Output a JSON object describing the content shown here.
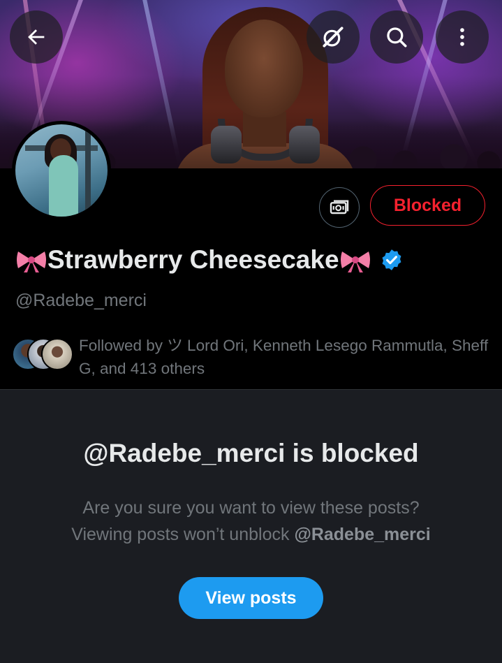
{
  "header": {
    "back_icon": "arrow-left-icon",
    "grok_icon": "grok-slash-icon",
    "search_icon": "search-icon",
    "more_icon": "more-vertical-icon"
  },
  "profile": {
    "display_name": "Strawberry Cheesecake",
    "name_emoji_left": "ribbon-emoji",
    "name_emoji_right": "ribbon-emoji",
    "verified_icon": "verified-badge-icon",
    "handle": "@Radebe_merci",
    "blocked_label": "Blocked",
    "tip_icon": "money-icon",
    "followed_by": "Followed by ツ Lord Ori, Kenneth Lesego Rammutla, Sheff G, and 413 others"
  },
  "blocked_notice": {
    "title": "@Radebe_merci is blocked",
    "desc_line1": "Are you sure you want to view these posts?",
    "desc_line2_prefix": "Viewing posts won’t unblock",
    "desc_line2_handle": "@Radebe_merci",
    "view_posts_label": "View posts"
  },
  "colors": {
    "accent": "#1d9bf0",
    "blocked_red": "#f4212e",
    "muted_text": "#71767b",
    "ribbon_pink": "#f47fa8"
  }
}
